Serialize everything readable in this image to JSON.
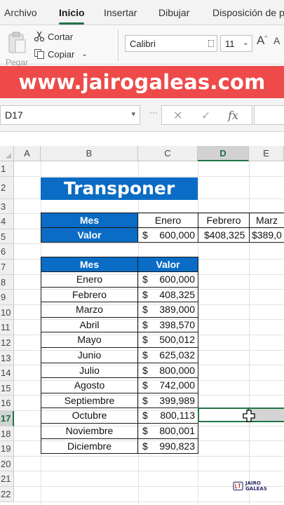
{
  "ribbon": {
    "tabs": [
      "Archivo",
      "Inicio",
      "Insertar",
      "Dibujar",
      "Disposición de p"
    ],
    "active_tab": "Inicio",
    "clipboard": {
      "paste": "Pegar",
      "cut": "Cortar",
      "copy": "Copiar"
    },
    "font_name": "Calibri",
    "font_size": "11"
  },
  "banner": {
    "text": "www.jairogaleas.com"
  },
  "formula_bar": {
    "name_box": "D17",
    "cancel": "✕",
    "enter": "✓",
    "fx": "fx"
  },
  "columns": [
    "A",
    "B",
    "C",
    "D",
    "E"
  ],
  "selected_column": "D",
  "rows": [
    "1",
    "2",
    "3",
    "4",
    "5",
    "6",
    "7",
    "8",
    "9",
    "10",
    "11",
    "12",
    "13",
    "14",
    "15",
    "16",
    "17",
    "18",
    "19",
    "20",
    "21",
    "22"
  ],
  "selected_row": "17",
  "title": "Transponer",
  "horizontal_table": {
    "row_mes": {
      "label": "Mes",
      "values": [
        "Enero",
        "Febrero",
        "Marz"
      ]
    },
    "row_valor": {
      "label": "Valor",
      "currency": "$",
      "values": [
        "600,000",
        "$408,325",
        "$389,0"
      ]
    }
  },
  "vertical_table": {
    "headers": [
      "Mes",
      "Valor"
    ],
    "currency": "$",
    "rows": [
      [
        "Enero",
        "600,000"
      ],
      [
        "Febrero",
        "408,325"
      ],
      [
        "Marzo",
        "389,000"
      ],
      [
        "Abril",
        "398,570"
      ],
      [
        "Mayo",
        "500,012"
      ],
      [
        "Junio",
        "625,032"
      ],
      [
        "Julio",
        "800,000"
      ],
      [
        "Agosto",
        "742,000"
      ],
      [
        "Septiembre",
        "399,989"
      ],
      [
        "Octubre",
        "800,113"
      ],
      [
        "Noviembre",
        "800,001"
      ],
      [
        "Diciembre",
        "990,823"
      ]
    ]
  },
  "watermark": {
    "text": "JAIRO GALEAS"
  },
  "colors": {
    "excel_green": "#217346",
    "banner_red": "#ee4a4a",
    "header_blue": "#0a6cc4"
  }
}
